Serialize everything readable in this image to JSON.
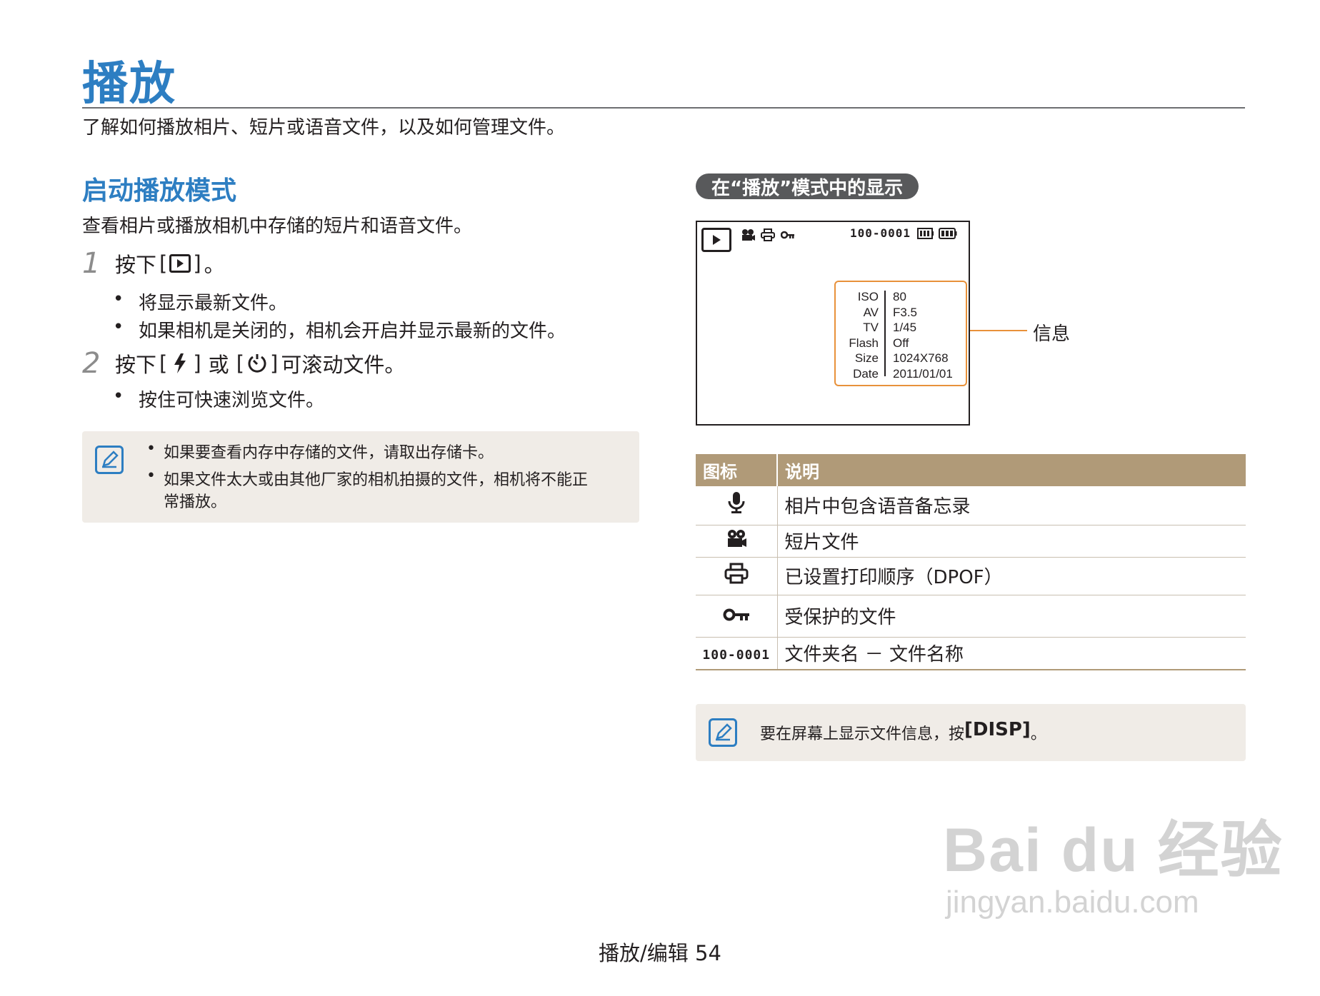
{
  "header": {
    "title": "播放",
    "intro": "了解如何播放相片、短片或语音文件，以及如何管理文件。"
  },
  "left": {
    "section_title": "启动播放模式",
    "section_desc": "查看相片或播放相机中存储的短片和语音文件。",
    "steps": [
      {
        "num": "1",
        "text_before": "按下",
        "key_left": "[",
        "key_right": "]",
        "text_after": "。",
        "key_icon": "play-icon",
        "bullets": [
          "将显示最新文件。",
          "如果相机是关闭的，相机会开启并显示最新的文件。"
        ]
      },
      {
        "num": "2",
        "text_before": "按下",
        "key_left": "[",
        "key_right": "]",
        "middle": "或",
        "text_after": "可滚动文件。",
        "key_icon": "flash-icon",
        "key_icon_2": "timer-icon",
        "bullets": [
          "按住可快速浏览文件。"
        ]
      }
    ],
    "note": {
      "icon": "note-icon",
      "items": [
        "如果要查看内存中存储的文件，请取出存储卡。",
        "如果文件太大或由其他厂家的相机拍摄的文件，相机将不能正",
        "常播放。"
      ]
    }
  },
  "right": {
    "pill_title": "在“播放”模式中的显示",
    "screen": {
      "file_id": "100-0001",
      "info_labels": [
        "ISO",
        "AV",
        "TV",
        "Flash",
        "Size",
        "Date"
      ],
      "info_values": [
        "80",
        "F3.5",
        "1/45",
        "Off",
        "1024X768",
        "2011/01/01"
      ],
      "callout": "信息"
    },
    "table": {
      "headers": [
        "图标",
        "说明"
      ],
      "rows": [
        {
          "icon": "microphone-icon",
          "desc": "相片中包含语音备忘录"
        },
        {
          "icon": "movie-camera-icon",
          "desc": "短片文件"
        },
        {
          "icon": "printer-icon",
          "desc": "已设置打印顺序（DPOF）"
        },
        {
          "icon": "key-icon",
          "desc": "受保护的文件"
        },
        {
          "icon_text": "100-0001",
          "desc": "文件夹名 － 文件名称"
        }
      ]
    },
    "note": {
      "icon": "note-icon",
      "text_before": "要在屏幕上显示文件信息，按",
      "key": "[DISP]",
      "text_after": "。"
    }
  },
  "footer": {
    "text": "播放/编辑  54"
  },
  "watermark": {
    "main": "Bai du 经验",
    "sub": "jingyan.baidu.com"
  },
  "colors": {
    "accent_blue": "#2d7ec2",
    "table_header": "#b09a78",
    "callout_orange": "#e8913a",
    "note_bg": "#f0ece7"
  }
}
